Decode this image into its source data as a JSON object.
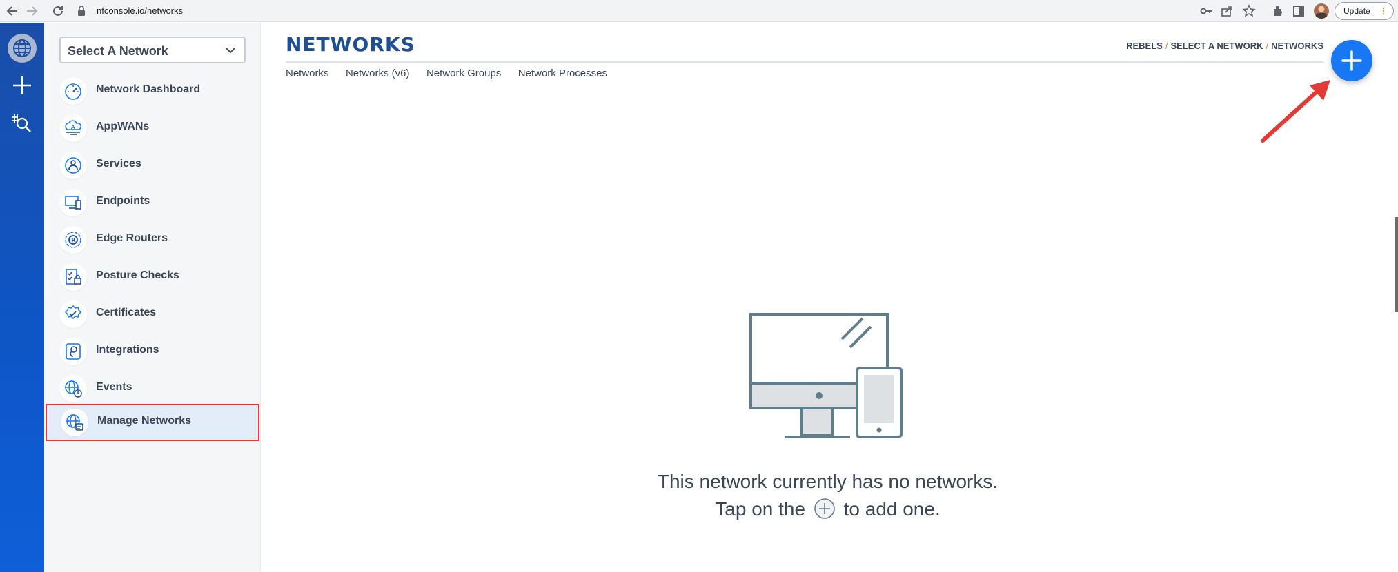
{
  "browser": {
    "url": "nfconsole.io/networks",
    "update_label": "Update",
    "icons": [
      "back-arrow-icon",
      "forward-arrow-icon",
      "reload-icon",
      "lock-icon",
      "key-icon",
      "share-icon",
      "star-icon",
      "extensions-icon",
      "side-panel-icon"
    ]
  },
  "rail": {
    "icons": [
      "globe-icon",
      "plus-icon",
      "hash-search-icon"
    ]
  },
  "sidebar": {
    "network_select": {
      "label": "Select A Network"
    },
    "items": [
      {
        "label": "Network Dashboard",
        "icon": "speedometer-icon"
      },
      {
        "label": "AppWANs",
        "icon": "appwan-cloud-icon"
      },
      {
        "label": "Services",
        "icon": "services-icon"
      },
      {
        "label": "Endpoints",
        "icon": "endpoints-icon"
      },
      {
        "label": "Edge Routers",
        "icon": "edge-router-icon"
      },
      {
        "label": "Posture Checks",
        "icon": "posture-check-icon"
      },
      {
        "label": "Certificates",
        "icon": "certificate-icon"
      },
      {
        "label": "Integrations",
        "icon": "integrations-icon"
      },
      {
        "label": "Events",
        "icon": "events-globe-icon"
      },
      {
        "label": "Manage Networks",
        "icon": "manage-networks-icon",
        "active": true
      }
    ]
  },
  "main": {
    "title": "NETWORKS",
    "breadcrumb": [
      "REBELS",
      "SELECT A NETWORK",
      "NETWORKS"
    ],
    "tabs": [
      "Networks",
      "Networks (v6)",
      "Network Groups",
      "Network Processes"
    ],
    "empty_message": "This network currently has no networks.",
    "empty_hint_before": "Tap on the",
    "empty_hint_after": "to add one."
  },
  "colors": {
    "accent": "#1877f2",
    "title": "#1d4e96",
    "rail": "#0d56c8",
    "highlight_border": "#e53935",
    "breadcrumb_separator": "#e67e22"
  }
}
